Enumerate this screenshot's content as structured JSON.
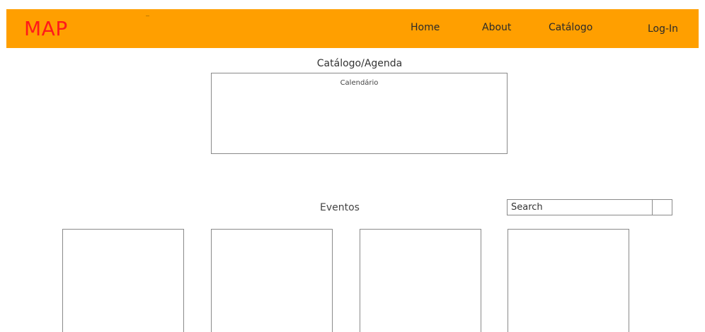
{
  "header": {
    "logo": "MAP",
    "nav": {
      "home": "Home",
      "about": "About",
      "catalog": "Catálogo",
      "login": "Log-In"
    },
    "brand_color": "#ff9f00",
    "logo_color": "#ff1a1a"
  },
  "catalog": {
    "title": "Catálogo/Agenda",
    "calendar_label": "Calendário"
  },
  "events": {
    "title": "Eventos",
    "search": {
      "value": "",
      "placeholder": "Search"
    },
    "cards_count": 4
  }
}
